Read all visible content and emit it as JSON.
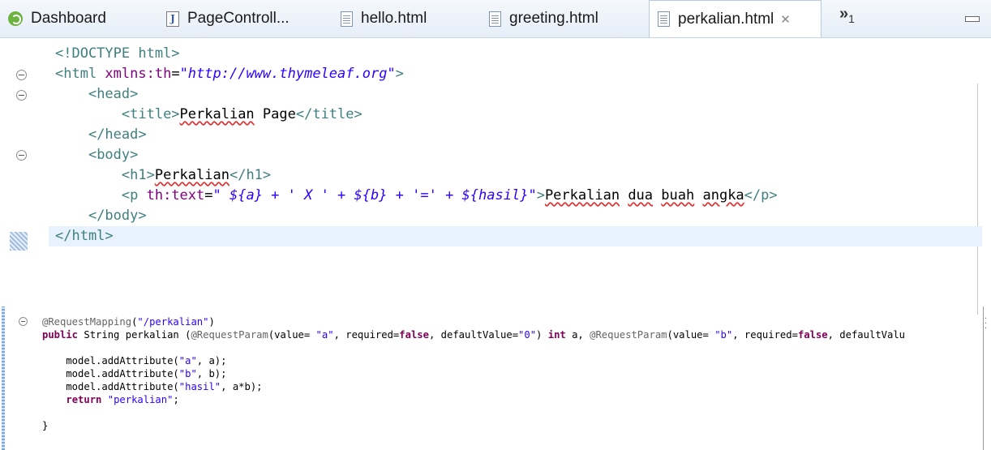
{
  "tabs": [
    {
      "label": "Dashboard",
      "icon": "spring-dashboard-icon",
      "active": false
    },
    {
      "label": "PageControll...",
      "icon": "java-file-icon",
      "active": false
    },
    {
      "label": "hello.html",
      "icon": "html-file-icon",
      "active": false
    },
    {
      "label": "greeting.html",
      "icon": "html-file-icon",
      "active": false
    },
    {
      "label": "perkalian.html",
      "icon": "html-file-icon",
      "active": true
    }
  ],
  "overflow_tabs": {
    "chevron": "»",
    "count": "1"
  },
  "editor_html": {
    "lines": [
      {
        "p": [
          {
            "c": "tg",
            "t": "<!DOCTYPE html>"
          }
        ]
      },
      {
        "p": [
          {
            "c": "tg",
            "t": "<html "
          },
          {
            "c": "an",
            "t": "xmlns:th"
          },
          {
            "c": "tx",
            "t": "="
          },
          {
            "c": "av",
            "t": "\"http://www.thymeleaf.org\""
          },
          {
            "c": "tg",
            "t": ">"
          }
        ]
      },
      {
        "p": [
          {
            "c": "tx",
            "t": "    "
          },
          {
            "c": "tg",
            "t": "<head>"
          }
        ]
      },
      {
        "p": [
          {
            "c": "tx",
            "t": "        "
          },
          {
            "c": "tg",
            "t": "<title>"
          },
          {
            "c": "tx sp",
            "t": "Perkalian"
          },
          {
            "c": "tx",
            "t": " Page"
          },
          {
            "c": "tg",
            "t": "</title>"
          }
        ]
      },
      {
        "p": [
          {
            "c": "tx",
            "t": "    "
          },
          {
            "c": "tg",
            "t": "</head>"
          }
        ]
      },
      {
        "p": [
          {
            "c": "tx",
            "t": "    "
          },
          {
            "c": "tg",
            "t": "<body>"
          }
        ]
      },
      {
        "p": [
          {
            "c": "tx",
            "t": "        "
          },
          {
            "c": "tg",
            "t": "<h1>"
          },
          {
            "c": "tx sp",
            "t": "Perkalian"
          },
          {
            "c": "tg",
            "t": "</h1>"
          }
        ]
      },
      {
        "p": [
          {
            "c": "tx",
            "t": "        "
          },
          {
            "c": "tg",
            "t": "<p "
          },
          {
            "c": "an",
            "t": "th:text"
          },
          {
            "c": "tx",
            "t": "="
          },
          {
            "c": "av",
            "t": "\" ${a} + ' X ' + ${b} + '=' + ${hasil}\""
          },
          {
            "c": "tg",
            "t": ">"
          },
          {
            "c": "tx sp",
            "t": "Perkalian"
          },
          {
            "c": "tx",
            "t": " "
          },
          {
            "c": "tx sp",
            "t": "dua"
          },
          {
            "c": "tx",
            "t": " "
          },
          {
            "c": "tx sp",
            "t": "buah"
          },
          {
            "c": "tx",
            "t": " "
          },
          {
            "c": "tx sp",
            "t": "angka"
          },
          {
            "c": "tg",
            "t": "</p>"
          }
        ]
      },
      {
        "p": [
          {
            "c": "tx",
            "t": "    "
          },
          {
            "c": "tg",
            "t": "</body>"
          }
        ]
      },
      {
        "p": [
          {
            "c": "tg",
            "t": "</html>"
          }
        ]
      }
    ]
  },
  "editor_java": {
    "lines": [
      {
        "p": [
          {
            "c": "ja",
            "t": "@RequestMapping"
          },
          {
            "c": "",
            "t": "("
          },
          {
            "c": "js",
            "t": "\"/perkalian\""
          },
          {
            "c": "",
            "t": ")"
          }
        ]
      },
      {
        "p": [
          {
            "c": "jk",
            "t": "public"
          },
          {
            "c": "",
            "t": " String perkalian ("
          },
          {
            "c": "ja",
            "t": "@RequestParam"
          },
          {
            "c": "",
            "t": "(value= "
          },
          {
            "c": "js",
            "t": "\"a\""
          },
          {
            "c": "",
            "t": ", required="
          },
          {
            "c": "jk",
            "t": "false"
          },
          {
            "c": "",
            "t": ", defaultValue="
          },
          {
            "c": "js",
            "t": "\"0\""
          },
          {
            "c": "",
            "t": ") "
          },
          {
            "c": "jk",
            "t": "int"
          },
          {
            "c": "",
            "t": " a, "
          },
          {
            "c": "ja",
            "t": "@RequestParam"
          },
          {
            "c": "",
            "t": "(value= "
          },
          {
            "c": "js",
            "t": "\"b\""
          },
          {
            "c": "",
            "t": ", required="
          },
          {
            "c": "jk",
            "t": "false"
          },
          {
            "c": "",
            "t": ", defaultValu"
          }
        ]
      },
      {
        "p": []
      },
      {
        "p": [
          {
            "c": "",
            "t": "    model.addAttribute("
          },
          {
            "c": "js",
            "t": "\"a\""
          },
          {
            "c": "",
            "t": ", a);"
          }
        ]
      },
      {
        "p": [
          {
            "c": "",
            "t": "    model.addAttribute("
          },
          {
            "c": "js",
            "t": "\"b\""
          },
          {
            "c": "",
            "t": ", b);"
          }
        ]
      },
      {
        "p": [
          {
            "c": "",
            "t": "    model.addAttribute("
          },
          {
            "c": "js",
            "t": "\"hasil\""
          },
          {
            "c": "",
            "t": ", a*b);"
          }
        ]
      },
      {
        "p": [
          {
            "c": "",
            "t": "    "
          },
          {
            "c": "jk",
            "t": "return"
          },
          {
            "c": "",
            "t": " "
          },
          {
            "c": "js",
            "t": "\"perkalian\""
          },
          {
            "c": "",
            "t": ";"
          }
        ]
      },
      {
        "p": []
      },
      {
        "p": [
          {
            "c": "",
            "t": "}"
          }
        ]
      }
    ]
  }
}
